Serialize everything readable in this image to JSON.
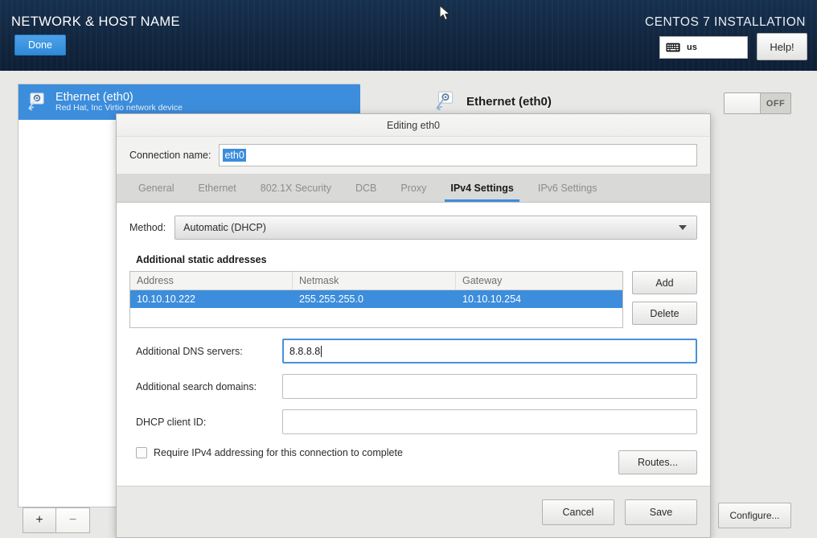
{
  "banner": {
    "title": "NETWORK & HOST NAME",
    "done_label": "Done",
    "installation_label": "CENTOS 7 INSTALLATION",
    "keyboard_icon": "keyboard-icon",
    "keyboard_layout": "us",
    "help_label": "Help!",
    "background_color": "#12263f",
    "accent_color": "#3c8ddc"
  },
  "device_list": {
    "selected_device": {
      "icon": "wired-network-icon",
      "name": "Ethernet (eth0)",
      "description": "Red Hat, Inc Virtio network device"
    },
    "add_label": "+",
    "remove_label": "−"
  },
  "device_panel": {
    "icon": "wired-network-icon",
    "title": "Ethernet (eth0)",
    "switch_state": "OFF",
    "configure_label": "Configure..."
  },
  "dialog": {
    "title": "Editing eth0",
    "connection_name_label": "Connection name:",
    "connection_name_value": "eth0",
    "tabs": [
      {
        "label": "General",
        "active": false
      },
      {
        "label": "Ethernet",
        "active": false
      },
      {
        "label": "802.1X Security",
        "active": false
      },
      {
        "label": "DCB",
        "active": false
      },
      {
        "label": "Proxy",
        "active": false
      },
      {
        "label": "IPv4 Settings",
        "active": true
      },
      {
        "label": "IPv6 Settings",
        "active": false
      }
    ],
    "method_label": "Method:",
    "method_value": "Automatic (DHCP)",
    "section_title": "Additional static addresses",
    "table": {
      "columns": [
        "Address",
        "Netmask",
        "Gateway"
      ],
      "rows": [
        {
          "address": "10.10.10.222",
          "netmask": "255.255.255.0",
          "gateway": "10.10.10.254",
          "selected": true
        }
      ],
      "add_label": "Add",
      "delete_label": "Delete"
    },
    "dns_label": "Additional DNS servers:",
    "dns_value": "8.8.8.8",
    "search_domains_label": "Additional search domains:",
    "search_domains_value": "",
    "dhcp_client_id_label": "DHCP client ID:",
    "dhcp_client_id_value": "",
    "require_ipv4_label": "Require IPv4 addressing for this connection to complete",
    "require_ipv4_checked": false,
    "routes_label": "Routes...",
    "cancel_label": "Cancel",
    "save_label": "Save"
  }
}
